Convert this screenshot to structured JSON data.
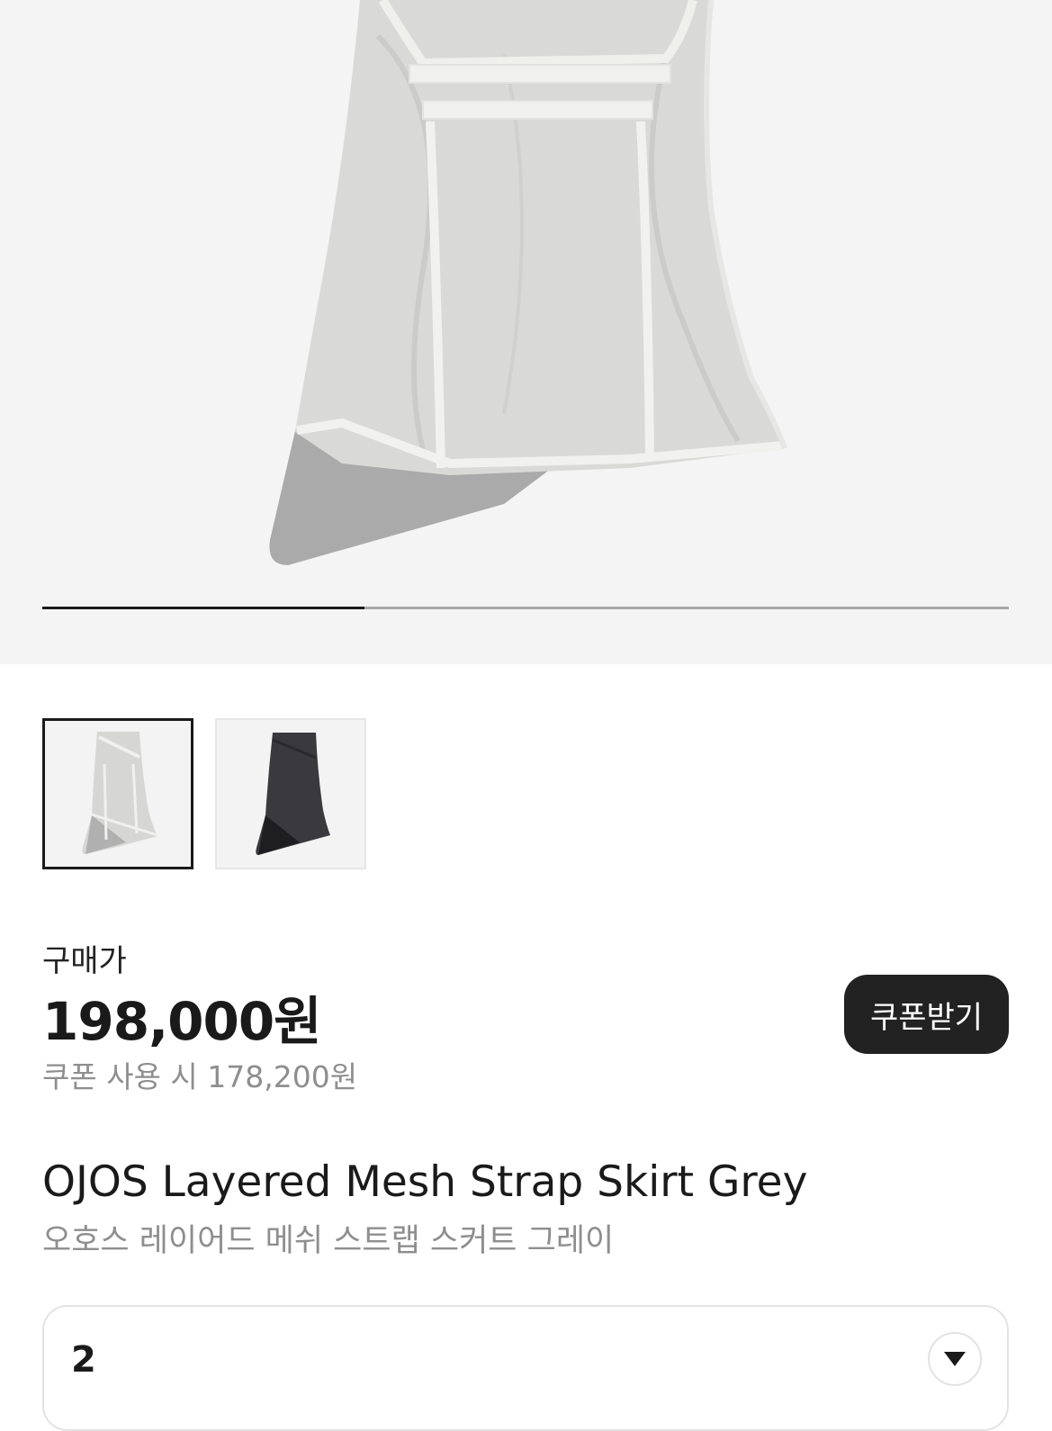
{
  "gallery": {
    "current_index": 1,
    "total_images": 3,
    "thumbnails": [
      {
        "name": "grey-skirt-thumbnail",
        "selected": true
      },
      {
        "name": "black-skirt-thumbnail",
        "selected": false
      }
    ]
  },
  "pricing": {
    "label": "구매가",
    "price": "198,000원",
    "coupon_price_text": "쿠폰 사용 시 178,200원",
    "coupon_button_label": "쿠폰받기"
  },
  "product": {
    "title_en": "OJOS Layered Mesh Strap Skirt Grey",
    "title_ko": "오호스 레이어드 메쉬 스트랩 스커트 그레이"
  },
  "option": {
    "selected_value": "2",
    "icon": "chevron-down-icon"
  },
  "colors": {
    "accent": "#222222",
    "muted_text": "#8e8e8e",
    "hero_background": "#f4f4f4"
  }
}
